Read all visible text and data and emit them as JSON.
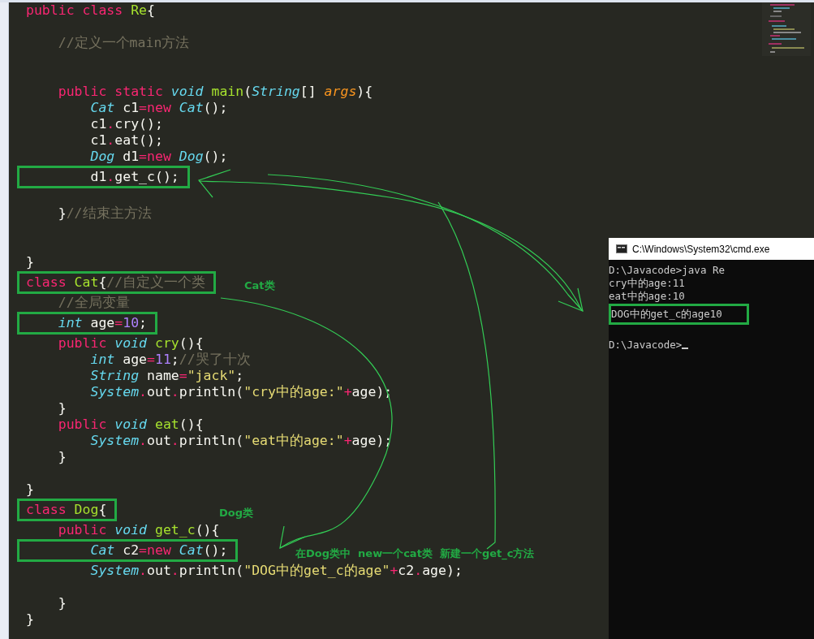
{
  "editor": {
    "lines": [
      {
        "kind": "code",
        "highlighted": false,
        "tokens": [
          {
            "kind": "kw",
            "text": "public class "
          },
          {
            "kind": "cls",
            "text": "Re"
          },
          {
            "kind": "plain",
            "text": "{"
          }
        ]
      },
      {
        "kind": "blank"
      },
      {
        "kind": "code",
        "highlighted": false,
        "tokens": [
          {
            "kind": "cmt",
            "text": "    //定义一个main方法"
          }
        ]
      },
      {
        "kind": "blank"
      },
      {
        "kind": "blank"
      },
      {
        "kind": "code",
        "highlighted": false,
        "tokens": [
          {
            "kind": "kw",
            "text": "    public static "
          },
          {
            "kind": "type",
            "text": "void "
          },
          {
            "kind": "fn",
            "text": "main"
          },
          {
            "kind": "plain",
            "text": "("
          },
          {
            "kind": "type",
            "text": "String"
          },
          {
            "kind": "plain",
            "text": "[] "
          },
          {
            "kind": "param",
            "text": "args"
          },
          {
            "kind": "plain",
            "text": "){"
          }
        ]
      },
      {
        "kind": "code",
        "highlighted": false,
        "tokens": [
          {
            "kind": "type",
            "text": "        Cat"
          },
          {
            "kind": "plain",
            "text": " c1"
          },
          {
            "kind": "op",
            "text": "="
          },
          {
            "kind": "kw",
            "text": "new "
          },
          {
            "kind": "type",
            "text": "Cat"
          },
          {
            "kind": "plain",
            "text": "();"
          }
        ]
      },
      {
        "kind": "code",
        "highlighted": false,
        "tokens": [
          {
            "kind": "plain",
            "text": "        c1"
          },
          {
            "kind": "op",
            "text": "."
          },
          {
            "kind": "plain",
            "text": "cry();"
          }
        ]
      },
      {
        "kind": "code",
        "highlighted": false,
        "tokens": [
          {
            "kind": "plain",
            "text": "        c1"
          },
          {
            "kind": "op",
            "text": "."
          },
          {
            "kind": "plain",
            "text": "eat();"
          }
        ]
      },
      {
        "kind": "code",
        "highlighted": false,
        "tokens": [
          {
            "kind": "type",
            "text": "        Dog"
          },
          {
            "kind": "plain",
            "text": " d1"
          },
          {
            "kind": "op",
            "text": "="
          },
          {
            "kind": "kw",
            "text": "new "
          },
          {
            "kind": "type",
            "text": "Dog"
          },
          {
            "kind": "plain",
            "text": "();"
          }
        ]
      },
      {
        "kind": "code",
        "highlighted": true,
        "tokens": [
          {
            "kind": "plain",
            "text": "        d1"
          },
          {
            "kind": "op",
            "text": "."
          },
          {
            "kind": "plain",
            "text": "get_c();"
          }
        ]
      },
      {
        "kind": "blank"
      },
      {
        "kind": "code",
        "highlighted": false,
        "tokens": [
          {
            "kind": "plain",
            "text": "    }"
          },
          {
            "kind": "cmt",
            "text": "//结束主方法"
          }
        ]
      },
      {
        "kind": "blank"
      },
      {
        "kind": "blank"
      },
      {
        "kind": "code",
        "highlighted": false,
        "tokens": [
          {
            "kind": "plain",
            "text": "}"
          }
        ]
      },
      {
        "kind": "code",
        "highlighted": true,
        "tokens": [
          {
            "kind": "kw",
            "text": "class "
          },
          {
            "kind": "cls",
            "text": "Cat"
          },
          {
            "kind": "plain",
            "text": "{"
          },
          {
            "kind": "cmt",
            "text": "//自定义一个类"
          }
        ]
      },
      {
        "kind": "code",
        "highlighted": false,
        "tokens": [
          {
            "kind": "cmt",
            "text": "    //全局变量"
          }
        ]
      },
      {
        "kind": "code",
        "highlighted": true,
        "tokens": [
          {
            "kind": "type",
            "text": "    int"
          },
          {
            "kind": "plain",
            "text": " age"
          },
          {
            "kind": "op",
            "text": "="
          },
          {
            "kind": "num",
            "text": "10"
          },
          {
            "kind": "plain",
            "text": ";"
          }
        ]
      },
      {
        "kind": "code",
        "highlighted": false,
        "tokens": [
          {
            "kind": "kw",
            "text": "    public "
          },
          {
            "kind": "type",
            "text": "void "
          },
          {
            "kind": "fn",
            "text": "cry"
          },
          {
            "kind": "plain",
            "text": "(){"
          }
        ]
      },
      {
        "kind": "code",
        "highlighted": false,
        "tokens": [
          {
            "kind": "type",
            "text": "        int"
          },
          {
            "kind": "plain",
            "text": " age"
          },
          {
            "kind": "op",
            "text": "="
          },
          {
            "kind": "num",
            "text": "11"
          },
          {
            "kind": "plain",
            "text": ";"
          },
          {
            "kind": "cmt",
            "text": "//哭了十次"
          }
        ]
      },
      {
        "kind": "code",
        "highlighted": false,
        "tokens": [
          {
            "kind": "type",
            "text": "        String"
          },
          {
            "kind": "plain",
            "text": " name"
          },
          {
            "kind": "op",
            "text": "="
          },
          {
            "kind": "str",
            "text": "\"jack\""
          },
          {
            "kind": "plain",
            "text": ";"
          }
        ]
      },
      {
        "kind": "code",
        "highlighted": false,
        "tokens": [
          {
            "kind": "type",
            "text": "        System"
          },
          {
            "kind": "op",
            "text": "."
          },
          {
            "kind": "plain",
            "text": "out"
          },
          {
            "kind": "op",
            "text": "."
          },
          {
            "kind": "plain",
            "text": "println("
          },
          {
            "kind": "str",
            "text": "\"cry中的age:\""
          },
          {
            "kind": "op",
            "text": "+"
          },
          {
            "kind": "plain",
            "text": "age);"
          }
        ]
      },
      {
        "kind": "code",
        "highlighted": false,
        "tokens": [
          {
            "kind": "plain",
            "text": "    }"
          }
        ]
      },
      {
        "kind": "code",
        "highlighted": false,
        "tokens": [
          {
            "kind": "kw",
            "text": "    public "
          },
          {
            "kind": "type",
            "text": "void "
          },
          {
            "kind": "fn",
            "text": "eat"
          },
          {
            "kind": "plain",
            "text": "(){"
          }
        ]
      },
      {
        "kind": "code",
        "highlighted": false,
        "tokens": [
          {
            "kind": "type",
            "text": "        System"
          },
          {
            "kind": "op",
            "text": "."
          },
          {
            "kind": "plain",
            "text": "out"
          },
          {
            "kind": "op",
            "text": "."
          },
          {
            "kind": "plain",
            "text": "println("
          },
          {
            "kind": "str",
            "text": "\"eat中的age:\""
          },
          {
            "kind": "op",
            "text": "+"
          },
          {
            "kind": "plain",
            "text": "age);"
          }
        ]
      },
      {
        "kind": "code",
        "highlighted": false,
        "tokens": [
          {
            "kind": "plain",
            "text": "    }"
          }
        ]
      },
      {
        "kind": "blank"
      },
      {
        "kind": "code",
        "highlighted": false,
        "tokens": [
          {
            "kind": "plain",
            "text": "}"
          }
        ]
      },
      {
        "kind": "code",
        "highlighted": true,
        "tokens": [
          {
            "kind": "kw",
            "text": "class "
          },
          {
            "kind": "cls",
            "text": "Dog"
          },
          {
            "kind": "plain",
            "text": "{"
          }
        ]
      },
      {
        "kind": "code",
        "highlighted": false,
        "tokens": [
          {
            "kind": "kw",
            "text": "    public "
          },
          {
            "kind": "type",
            "text": "void "
          },
          {
            "kind": "fn",
            "text": "get_c"
          },
          {
            "kind": "plain",
            "text": "(){"
          }
        ]
      },
      {
        "kind": "code",
        "highlighted": true,
        "tokens": [
          {
            "kind": "type",
            "text": "        Cat"
          },
          {
            "kind": "plain",
            "text": " c2"
          },
          {
            "kind": "op",
            "text": "="
          },
          {
            "kind": "kw",
            "text": "new "
          },
          {
            "kind": "type",
            "text": "Cat"
          },
          {
            "kind": "plain",
            "text": "();"
          }
        ]
      },
      {
        "kind": "code",
        "highlighted": false,
        "tokens": [
          {
            "kind": "type",
            "text": "        System"
          },
          {
            "kind": "op",
            "text": "."
          },
          {
            "kind": "plain",
            "text": "out"
          },
          {
            "kind": "op",
            "text": "."
          },
          {
            "kind": "plain",
            "text": "println("
          },
          {
            "kind": "str",
            "text": "\"DOG中的get_c的age\""
          },
          {
            "kind": "op",
            "text": "+"
          },
          {
            "kind": "plain",
            "text": "c2"
          },
          {
            "kind": "op",
            "text": "."
          },
          {
            "kind": "plain",
            "text": "age);"
          }
        ]
      },
      {
        "kind": "blank"
      },
      {
        "kind": "code",
        "highlighted": false,
        "tokens": [
          {
            "kind": "plain",
            "text": "    }"
          }
        ]
      },
      {
        "kind": "code",
        "highlighted": false,
        "tokens": [
          {
            "kind": "plain",
            "text": "}"
          }
        ]
      }
    ]
  },
  "console": {
    "title": "C:\\Windows\\System32\\cmd.exe",
    "lines": [
      {
        "kind": "text",
        "text": "D:\\Javacode>java Re",
        "highlighted": false,
        "cursor": false
      },
      {
        "kind": "text",
        "text": "cry中的age:11",
        "highlighted": false,
        "cursor": false
      },
      {
        "kind": "text",
        "text": "eat中的age:10",
        "highlighted": false,
        "cursor": false
      },
      {
        "kind": "text",
        "text": "DOG中的get_c的age10",
        "highlighted": true,
        "cursor": false
      },
      {
        "kind": "blank"
      },
      {
        "kind": "text",
        "text": "D:\\Javacode>",
        "highlighted": false,
        "cursor": true
      }
    ]
  },
  "annotations": {
    "labels": [
      {
        "text": "Cat类"
      },
      {
        "text": "Dog类"
      },
      {
        "text": "在Dog类中  new一个cat类  新建一个get_c方法"
      }
    ]
  }
}
